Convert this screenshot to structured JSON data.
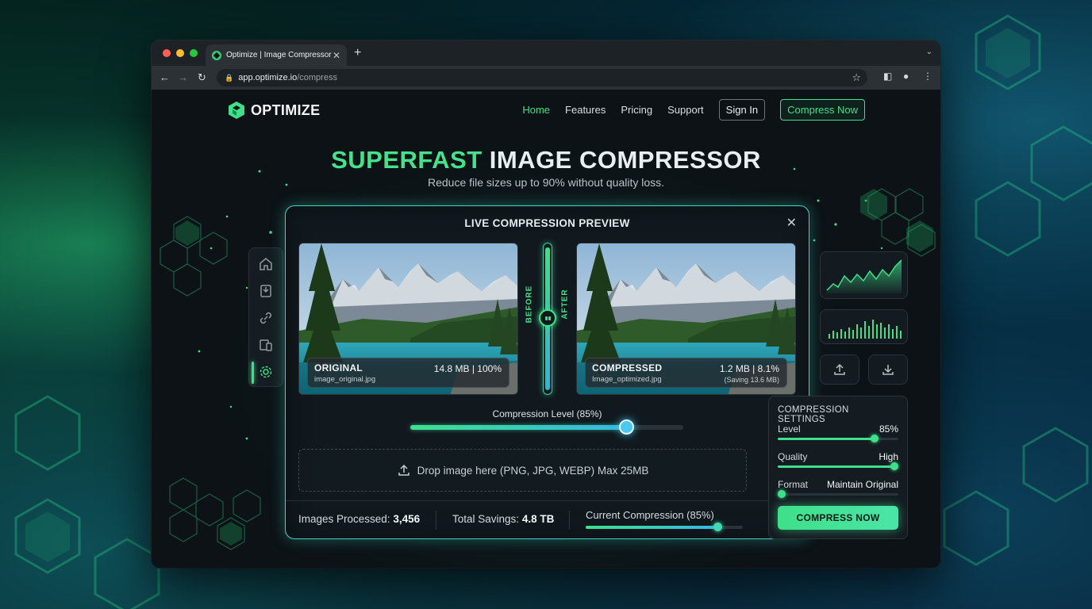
{
  "browser": {
    "tab_title": "Optimize | Image Compressor",
    "url_domain": "app.optimize.io",
    "url_path": "/compress"
  },
  "header": {
    "logo_text": "OPTIMIZE",
    "nav": [
      "Home",
      "Features",
      "Pricing",
      "Support"
    ],
    "sign_in": "Sign In",
    "cta": "Compress Now"
  },
  "hero": {
    "title_accent": "SUPERFAST",
    "title_rest": "IMAGE COMPRESSOR",
    "subtitle": "Reduce file sizes up to 90% without quality loss."
  },
  "preview": {
    "title": "LIVE COMPRESSION PREVIEW",
    "before_label": "BEFORE",
    "after_label": "AFTER",
    "original": {
      "name": "ORIGINAL",
      "file": "image_original.jpg",
      "size": "14.8 MB",
      "percent": "100%"
    },
    "compressed": {
      "name": "COMPRESSED",
      "file": "Image_optimized.jpg",
      "size": "1.2 MB",
      "percent": "8.1%",
      "saving": "(Saving 13.6 MB)"
    },
    "compression_label": "Compression Level (85%)",
    "compression_level": 0.79,
    "dropzone_text": "Drop image here (PNG, JPG, WEBP) Max 25MB"
  },
  "stats": {
    "processed_label": "Images Processed:",
    "processed_value": "3,456",
    "savings_label": "Total Savings:",
    "savings_value": "4.8 TB",
    "current_label": "Current Compression (85%)",
    "current_level": 0.84
  },
  "settings": {
    "title": "COMPRESSION SETTINGS",
    "level_label": "Level",
    "level_value": "85%",
    "level_fill": 0.8,
    "quality_label": "Quality",
    "quality_value": "High",
    "quality_fill": 0.97,
    "format_label": "Format",
    "format_value": "Maintain Original",
    "format_fill": 0.03,
    "button": "COMPRESS NOW"
  },
  "colors": {
    "accent": "#3ee08a",
    "card_border": "#3bd4c6",
    "background": "#0c1216"
  }
}
